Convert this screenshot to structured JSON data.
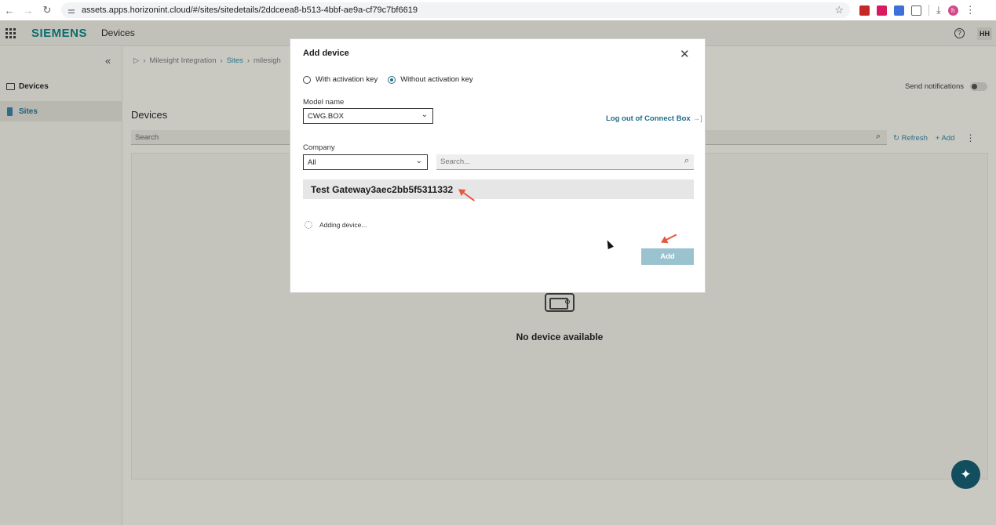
{
  "browser": {
    "url": "assets.apps.horizonint.cloud/#/sites/sitedetails/2ddceea8-b513-4bbf-ae9a-cf79c7bf6619",
    "profile_initial": "h"
  },
  "header": {
    "logo": "SIEMENS",
    "app_title": "Devices",
    "help": "?",
    "user_initials": "HH"
  },
  "sidebar": {
    "items": [
      {
        "label": "Devices"
      },
      {
        "label": "Sites"
      }
    ]
  },
  "breadcrumb": [
    "Milesight Integration",
    "Sites",
    "milesigh"
  ],
  "main": {
    "title": "Devices",
    "search_placeholder": "Search",
    "send_notifications_label": "Send notifications",
    "refresh_label": "Refresh",
    "add_label": "+ Add",
    "empty_text": "No device available"
  },
  "modal": {
    "title": "Add device",
    "radio_with_key": "With activation key",
    "radio_without_key": "Without activation key",
    "selected_option": "Without activation key",
    "model_label": "Model name",
    "model_value": "CWG.BOX",
    "logout_label": "Log out of Connect Box",
    "company_label": "Company",
    "company_value": "All",
    "search_placeholder": "Search...",
    "device_name": "Test Gateway3aec2bb5f5311332",
    "status_text": "Adding device...",
    "add_button": "Add"
  },
  "colors": {
    "accent": "#0c6e6e",
    "link": "#1f6c87",
    "add_button_disabled": "#9ac2cf",
    "annotation_arrow": "#e8553d"
  }
}
